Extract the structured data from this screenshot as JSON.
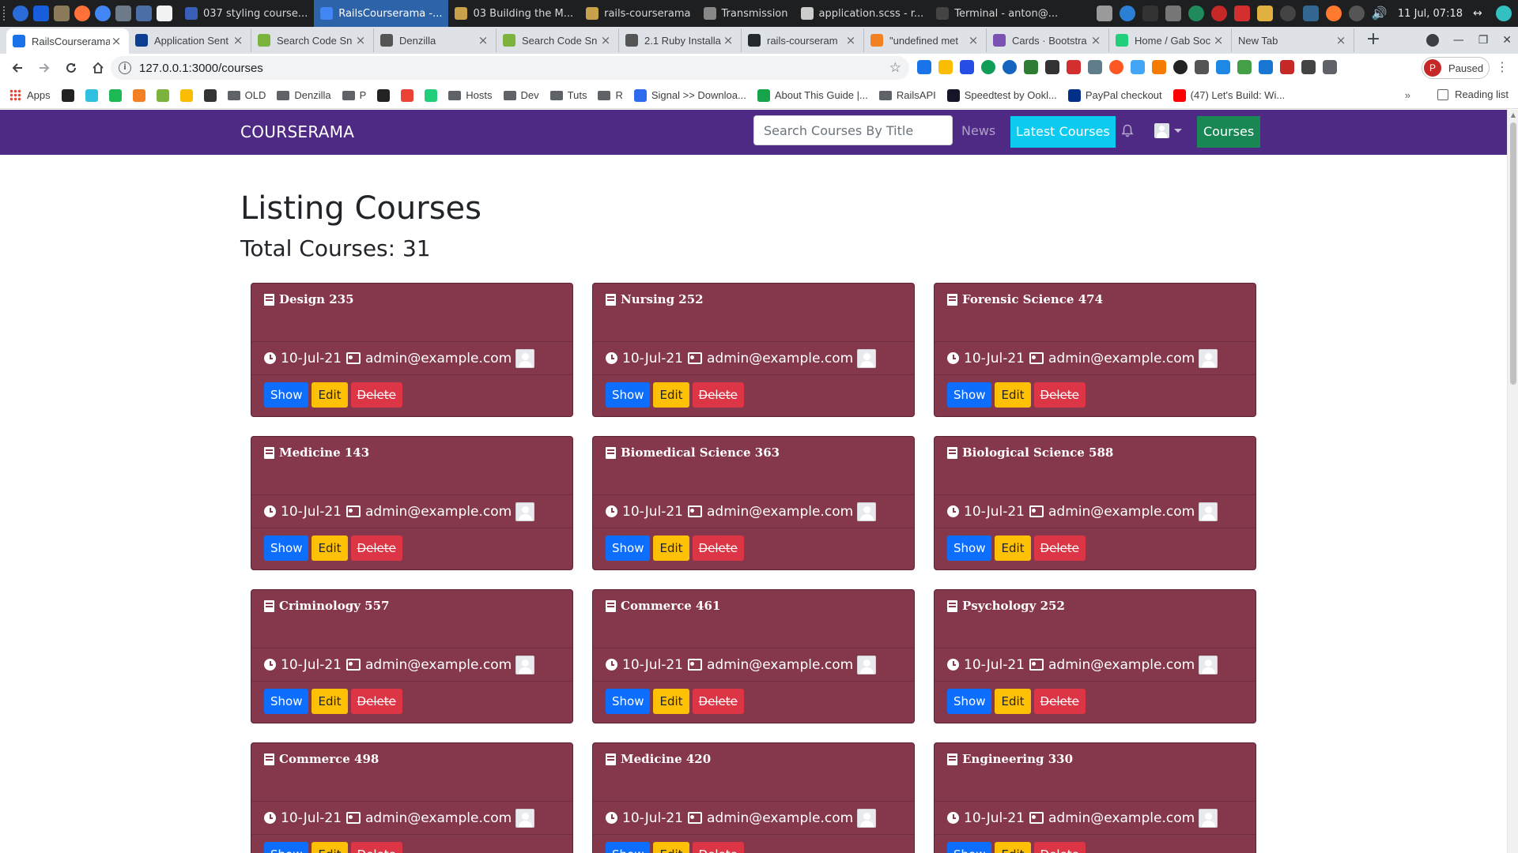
{
  "os_panel": {
    "taskbar": [
      {
        "label": "037 styling course...",
        "icon": "video-player-icon",
        "color": "#3a5fb8",
        "active": false
      },
      {
        "label": "RailsCourserama -...",
        "icon": "chrome-icon",
        "color": "#4285f4",
        "active": true
      },
      {
        "label": "03 Building the M...",
        "icon": "folder-icon",
        "color": "#c8a24a",
        "active": false
      },
      {
        "label": "rails-courserama",
        "icon": "folder-icon",
        "color": "#c8a24a",
        "active": false
      },
      {
        "label": "Transmission",
        "icon": "transmission-icon",
        "color": "#888888",
        "active": false
      },
      {
        "label": "application.scss - r...",
        "icon": "editor-icon",
        "color": "#cccccc",
        "active": false
      },
      {
        "label": "Terminal - anton@...",
        "icon": "terminal-icon",
        "color": "#444444",
        "active": false
      }
    ],
    "clock": "11 Jul, 07:18"
  },
  "browser": {
    "tabs": [
      {
        "label": "RailsCourserama",
        "color": "#1a73e8",
        "active": true
      },
      {
        "label": "Application Sent",
        "color": "#0b3d91",
        "active": false
      },
      {
        "label": "Search Code Sn",
        "color": "#7bb33d",
        "active": false
      },
      {
        "label": "Denzilla",
        "color": "#555555",
        "active": false
      },
      {
        "label": "Search Code Sn",
        "color": "#7bb33d",
        "active": false
      },
      {
        "label": "2.1 Ruby Installa",
        "color": "#555555",
        "active": false
      },
      {
        "label": "rails-courseram",
        "color": "#24292e",
        "active": false
      },
      {
        "label": "\"undefined met",
        "color": "#f48024",
        "active": false
      },
      {
        "label": "Cards · Bootstra",
        "color": "#7952b3",
        "active": false
      },
      {
        "label": "Home / Gab Soc",
        "color": "#21cf7a",
        "active": false
      },
      {
        "label": "New Tab",
        "color": "",
        "active": false
      }
    ],
    "url": "127.0.0.1:3000/courses",
    "profile_label": "Paused",
    "profile_initial": "P",
    "bookmarks": [
      {
        "label": "Apps",
        "type": "apps"
      },
      {
        "label": "",
        "type": "icon",
        "color": "#222222"
      },
      {
        "label": "",
        "type": "icon",
        "color": "#30c0e0"
      },
      {
        "label": "",
        "type": "icon",
        "color": "#1db954"
      },
      {
        "label": "",
        "type": "icon",
        "color": "#f48024"
      },
      {
        "label": "",
        "type": "icon",
        "color": "#7bb33d"
      },
      {
        "label": "",
        "type": "icon",
        "color": "#fbbc04"
      },
      {
        "label": "",
        "type": "icon",
        "color": "#333333"
      },
      {
        "label": "OLD",
        "type": "folder"
      },
      {
        "label": "Denzilla",
        "type": "folder"
      },
      {
        "label": "P",
        "type": "folder"
      },
      {
        "label": "",
        "type": "icon",
        "color": "#222222"
      },
      {
        "label": "",
        "type": "icon",
        "color": "#ea4335"
      },
      {
        "label": "",
        "type": "icon",
        "color": "#21cf7a"
      },
      {
        "label": "Hosts",
        "type": "folder"
      },
      {
        "label": "Dev",
        "type": "folder"
      },
      {
        "label": "Tuts",
        "type": "folder"
      },
      {
        "label": "R",
        "type": "folder"
      },
      {
        "label": "Signal >> Downloa...",
        "type": "icon",
        "color": "#2c6bed"
      },
      {
        "label": "About This Guide |...",
        "type": "icon",
        "color": "#16a34a"
      },
      {
        "label": "RailsAPI",
        "type": "folder"
      },
      {
        "label": "Speedtest by Ookl...",
        "type": "icon",
        "color": "#141526"
      },
      {
        "label": "PayPal checkout",
        "type": "icon",
        "color": "#003087"
      },
      {
        "label": "(47) Let's Build: Wi...",
        "type": "icon",
        "color": "#ff0000"
      }
    ],
    "bookmarks_more": "»",
    "reading_list": "Reading list"
  },
  "app": {
    "brand": "COURSERAMA",
    "search_placeholder": "Search Courses By Title",
    "nav_news": "News",
    "nav_latest": "Latest Courses",
    "nav_courses": "Courses",
    "colors": {
      "navbar": "#4e2a84",
      "card": "#85374b"
    }
  },
  "page": {
    "title": "Listing Courses",
    "total": "Total Courses: 31"
  },
  "courses": [
    {
      "title": "Design 235",
      "date": "10-Jul-21",
      "author": "admin@example.com"
    },
    {
      "title": "Nursing 252",
      "date": "10-Jul-21",
      "author": "admin@example.com"
    },
    {
      "title": "Forensic Science 474",
      "date": "10-Jul-21",
      "author": "admin@example.com"
    },
    {
      "title": "Medicine 143",
      "date": "10-Jul-21",
      "author": "admin@example.com"
    },
    {
      "title": "Biomedical Science 363",
      "date": "10-Jul-21",
      "author": "admin@example.com"
    },
    {
      "title": "Biological Science 588",
      "date": "10-Jul-21",
      "author": "admin@example.com"
    },
    {
      "title": "Criminology 557",
      "date": "10-Jul-21",
      "author": "admin@example.com"
    },
    {
      "title": "Commerce 461",
      "date": "10-Jul-21",
      "author": "admin@example.com"
    },
    {
      "title": "Psychology 252",
      "date": "10-Jul-21",
      "author": "admin@example.com"
    },
    {
      "title": "Commerce 498",
      "date": "10-Jul-21",
      "author": "admin@example.com"
    },
    {
      "title": "Medicine 420",
      "date": "10-Jul-21",
      "author": "admin@example.com"
    },
    {
      "title": "Engineering 330",
      "date": "10-Jul-21",
      "author": "admin@example.com"
    }
  ],
  "course_actions": {
    "show": "Show",
    "edit": "Edit",
    "delete": "Delete"
  }
}
